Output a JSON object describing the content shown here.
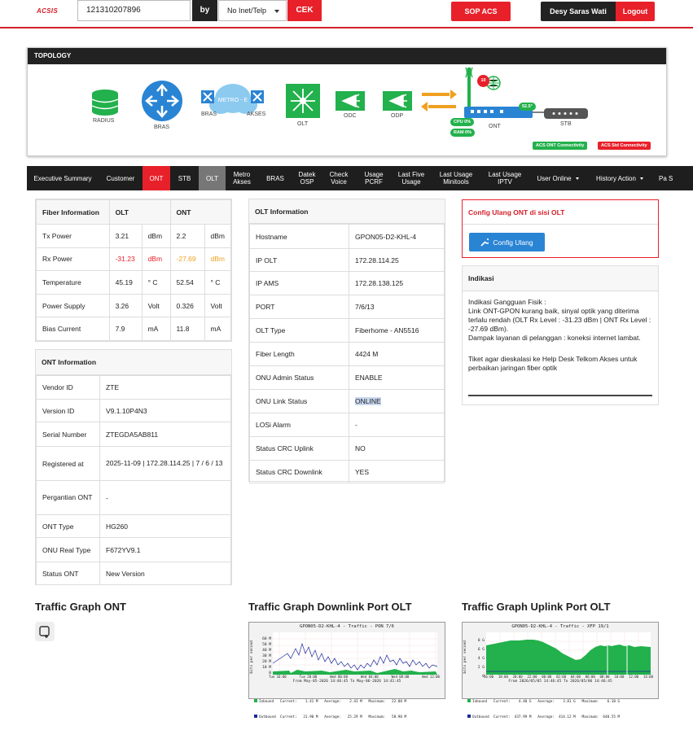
{
  "header": {
    "logo": "ACSIS",
    "search_value": "121310207896",
    "by_label": "by",
    "select_value": "No Inet/Telp",
    "cek_label": "CEK",
    "sop_label": "SOP ACS",
    "user_name": "Desy Saras Wati",
    "logout_label": "Logout"
  },
  "topology": {
    "title": "TOPOLOGY",
    "nodes": {
      "radius": "RADIUS",
      "bras": "BRAS",
      "bras2": "BRAS",
      "metro": "METRO - E",
      "akses": "AKSES",
      "olt": "OLT",
      "odc": "ODC",
      "odp": "ODP",
      "ont": "ONT",
      "stb": "STB"
    },
    "notif_count": "10",
    "temp": "52.5°",
    "cpu": "CPU 0%",
    "ram": "RAM 0%",
    "badge_ont": "ACS ONT Connectivity",
    "badge_stb": "ACS Std Connectivity",
    "colors": {
      "green": "#22b14c",
      "red": "#e8202a",
      "blue": "#2a84d4",
      "orange": "#f0a020"
    }
  },
  "nav": {
    "items": [
      {
        "label": "Executive Summary"
      },
      {
        "label": "Customer"
      },
      {
        "label": "ONT"
      },
      {
        "label": "STB"
      },
      {
        "label": "OLT"
      },
      {
        "label": "Metro Akses"
      },
      {
        "label": "BRAS"
      },
      {
        "label": "Datek OSP"
      },
      {
        "label": "Check Voice"
      },
      {
        "label": "Usage PCRF"
      },
      {
        "label": "Last Five Usage"
      },
      {
        "label": "Last Usage Minitools"
      },
      {
        "label": "Last Usage IPTV"
      },
      {
        "label": "User Online"
      },
      {
        "label": "History Action"
      },
      {
        "label": "Pa S"
      }
    ]
  },
  "fiber": {
    "headers": [
      "Fiber Information",
      "OLT",
      "ONT"
    ],
    "rows": [
      {
        "label": "Tx Power",
        "olt": "3.21",
        "olt_unit": "dBm",
        "ont": "2.2",
        "ont_unit": "dBm"
      },
      {
        "label": "Rx Power",
        "olt": "-31.23",
        "olt_unit": "dBm",
        "ont": "-27.69",
        "ont_unit": "dBm"
      },
      {
        "label": "Temperature",
        "olt": "45.19",
        "olt_unit": "° C",
        "ont": "52.54",
        "ont_unit": "° C"
      },
      {
        "label": "Power Supply",
        "olt": "3.26",
        "olt_unit": "Volt",
        "ont": "0.326",
        "ont_unit": "Volt"
      },
      {
        "label": "Bias Current",
        "olt": "7.9",
        "olt_unit": "mA",
        "ont": "11.8",
        "ont_unit": "mA"
      }
    ]
  },
  "ont_info": {
    "title": "ONT Information",
    "rows": [
      {
        "label": "Vendor ID",
        "value": "ZTE"
      },
      {
        "label": "Version ID",
        "value": "V9.1.10P4N3"
      },
      {
        "label": "Serial Number",
        "value": "ZTEGDA5AB811"
      },
      {
        "label": "Registered at",
        "value": "2025-11-09 | 172.28.114.25 | 7 / 6 / 13"
      },
      {
        "label": "Pergantian ONT",
        "value": "-"
      },
      {
        "label": "ONT Type",
        "value": "HG260"
      },
      {
        "label": "ONU Real Type",
        "value": "F672YV9.1"
      },
      {
        "label": "Status ONT",
        "value": "New Version"
      }
    ]
  },
  "olt_info": {
    "title": "OLT Information",
    "rows": [
      {
        "label": "Hostname",
        "value": "GPON05-D2-KHL-4"
      },
      {
        "label": "IP OLT",
        "value": "172.28.114.25"
      },
      {
        "label": "IP AMS",
        "value": "172.28.138.125"
      },
      {
        "label": "PORT",
        "value": "7/6/13"
      },
      {
        "label": "OLT Type",
        "value": "Fiberhome - AN5516"
      },
      {
        "label": "Fiber Length",
        "value": "4424 M"
      },
      {
        "label": "ONU Admin Status",
        "value": "ENABLE"
      },
      {
        "label": "ONU Link Status",
        "value": "ONLINE"
      },
      {
        "label": "LOSi Alarm",
        "value": "-"
      },
      {
        "label": "Status CRC Uplink",
        "value": "NO"
      },
      {
        "label": "Status CRC Downlink",
        "value": "YES"
      }
    ]
  },
  "config": {
    "title": "Config Ulang ONT di sisi OLT",
    "button": "Config Ulang"
  },
  "indikasi": {
    "title": "Indikasi",
    "line1": "Indikasi Gangguan Fisik :",
    "line2": "Link ONT-GPON kurang baik, sinyal optik yang diterima terlalu rendah (OLT Rx Level : -31.23 dBm | ONT Rx Level : -27.69 dBm).",
    "line3": "Dampak layanan di pelanggan : koneksi internet lambat.",
    "line4": "Tiket agar dieskalasi ke Help Desk Telkom Akses untuk perbaikan jaringan fiber optik"
  },
  "graphs": {
    "ont_title": "Traffic Graph ONT",
    "down_title": "Traffic Graph Downlink Port OLT",
    "up_title": "Traffic Graph Uplink Port OLT",
    "down_header": "GPON05-D2-KHL-4 - Traffic - PON 7/6",
    "up_header": "GPON05-D2-KHL-4 - Traffic - XFP 19/1",
    "down_ylabel": "bits per second",
    "up_ylabel": "bits per second",
    "down_yticks": [
      "60 M",
      "50 M",
      "40 M",
      "30 M",
      "20 M",
      "10 M",
      "0"
    ],
    "up_yticks": [
      "8 G",
      "6 G",
      "4 G",
      "2 G",
      "0"
    ],
    "down_xticks": [
      "Tue 16:00",
      "Tue 20:00",
      "Wed 00:00",
      "Wed 04:00",
      "Wed 08:00",
      "Wed 12:00"
    ],
    "up_xticks": [
      "16:00",
      "18:00",
      "20:00",
      "22:00",
      "00:00",
      "02:00",
      "04:00",
      "06:00",
      "08:00",
      "10:00",
      "12:00",
      "14:00"
    ],
    "down_from": "From May-05-2026 14:46:45 To May-06-2026 14:41:45",
    "up_from": "From 2026/05/05 14:46:45 To 2026/05/06 14:46:45",
    "down_in": "Inbound   Current:    1.41 M   Average:    2.43 M   Maximum:   22.88 M",
    "down_out": "Outbound  Current:   21.90 M   Average:   25.29 M   Maximum:   58.90 M",
    "up_in": "Inbound   Current:    4.40 G   Average:    3.81 G   Maximum:    6.10 G",
    "up_out": "Outbound  Current:  437.99 M   Average:  414.12 M   Maximum:  640.55 M"
  }
}
